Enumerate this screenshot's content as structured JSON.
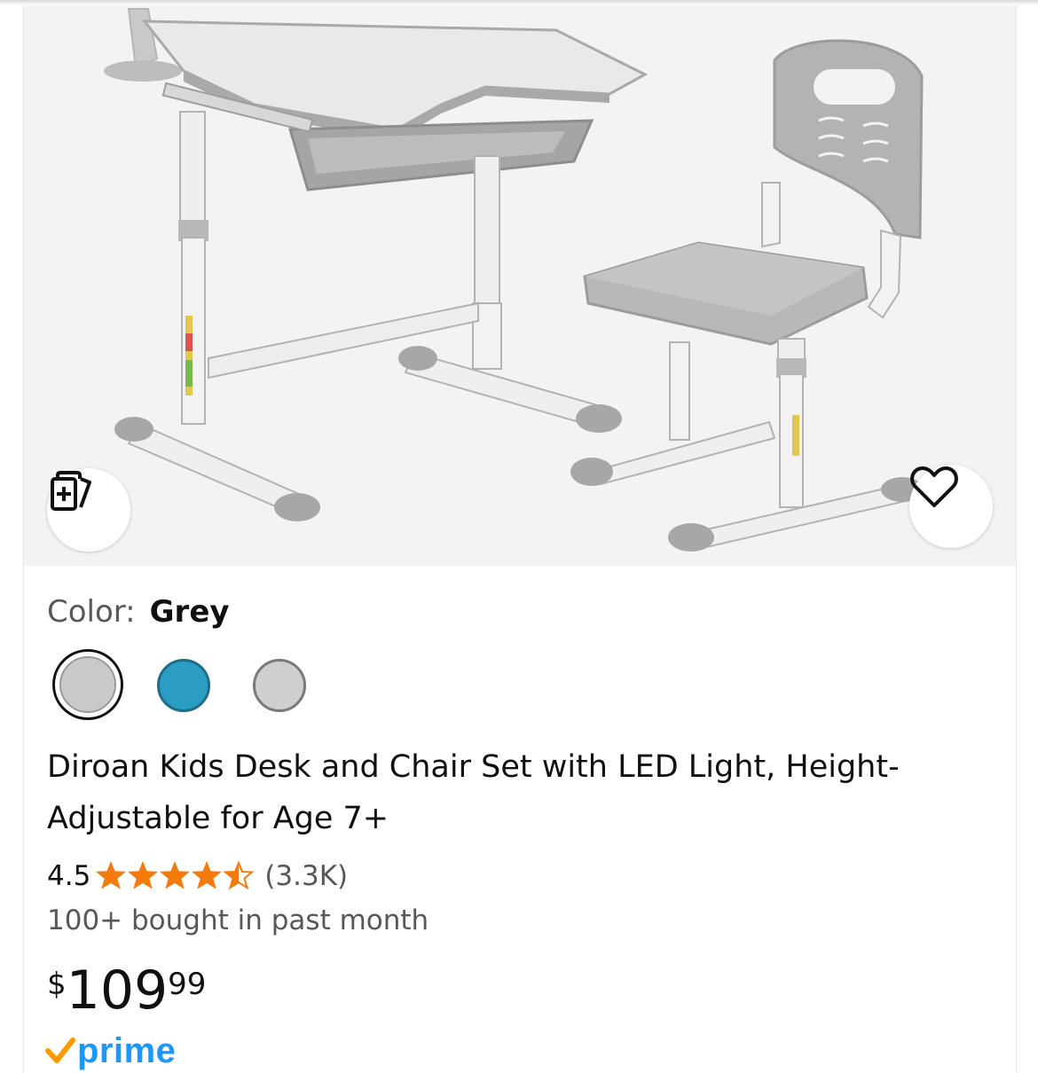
{
  "product": {
    "image": {
      "alt": "Grey kids desk with tilting top and drawer, and matching grey chair",
      "compare_icon": "compare-cards-plus-icon",
      "wishlist_icon": "heart-outline-icon"
    },
    "color": {
      "label": "Color:",
      "selected": "Grey",
      "swatches": [
        {
          "name": "Grey",
          "hex": "#c9c9c9",
          "selected": true
        },
        {
          "name": "Blue",
          "hex": "#2b9cc2",
          "selected": false
        },
        {
          "name": "Grey",
          "hex": "#cfcfcf",
          "selected": false
        }
      ]
    },
    "title": "Diroan Kids Desk and Chair Set with LED Light, Height-Adjustable for Age 7+",
    "rating": {
      "value": "4.5",
      "stars": 4.5,
      "count": "(3.3K)",
      "star_color": "#f47b0c"
    },
    "bought": "100+ bought in past month",
    "price": {
      "symbol": "$",
      "whole": "109",
      "fraction": "99"
    },
    "prime": {
      "label": "prime",
      "check_color": "#ff9900",
      "text_color": "#1a98ff"
    }
  }
}
